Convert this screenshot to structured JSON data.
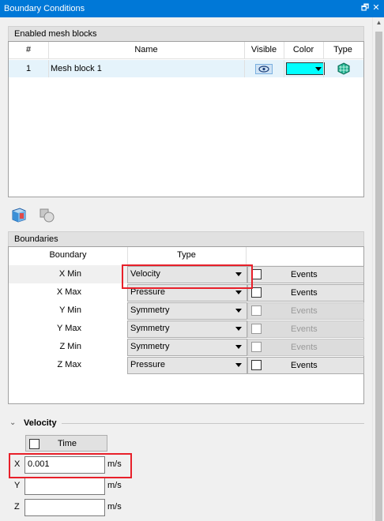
{
  "window": {
    "title": "Boundary Conditions",
    "restore_glyph": "🗗",
    "close_glyph": "✕"
  },
  "mesh_blocks": {
    "header": "Enabled mesh blocks",
    "columns": [
      "#",
      "Name",
      "Visible",
      "Color",
      "Type"
    ],
    "rows": [
      {
        "index": "1",
        "name": "Mesh block 1",
        "visible_icon": "eye-icon",
        "color": "#00ffff",
        "type_icon": "mesh-block-icon"
      }
    ]
  },
  "toolbar": {
    "icons": [
      "cube-icon",
      "boolean-shapes-icon"
    ]
  },
  "boundaries": {
    "header": "Boundaries",
    "columns": [
      "Boundary",
      "Type"
    ],
    "rows": [
      {
        "boundary": "X Min",
        "type": "Velocity",
        "events": "Events",
        "events_enabled": true
      },
      {
        "boundary": "X Max",
        "type": "Pressure",
        "events": "Events",
        "events_enabled": true
      },
      {
        "boundary": "Y Min",
        "type": "Symmetry",
        "events": "Events",
        "events_enabled": false
      },
      {
        "boundary": "Y Max",
        "type": "Symmetry",
        "events": "Events",
        "events_enabled": false
      },
      {
        "boundary": "Z Min",
        "type": "Symmetry",
        "events": "Events",
        "events_enabled": false
      },
      {
        "boundary": "Z Max",
        "type": "Pressure",
        "events": "Events",
        "events_enabled": true
      }
    ]
  },
  "velocity": {
    "title": "Velocity",
    "time_label": "Time",
    "fields": [
      {
        "axis": "X",
        "value": "0.001",
        "unit": "m/s"
      },
      {
        "axis": "Y",
        "value": "",
        "unit": "m/s"
      },
      {
        "axis": "Z",
        "value": "",
        "unit": "m/s"
      }
    ]
  },
  "colors": {
    "accent": "#0078d7",
    "highlight": "#e8202a",
    "selected_row": "#e5f3fb"
  }
}
